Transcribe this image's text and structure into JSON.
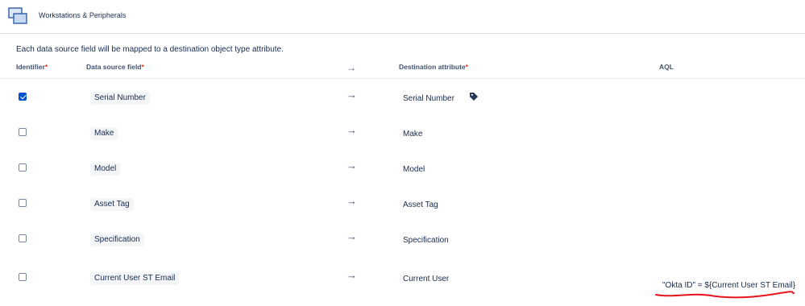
{
  "header": {
    "title": "Workstations & Peripherals",
    "icon": "object-type-icon"
  },
  "description": "Each data source field will be mapped to a destination object type attribute.",
  "columns": {
    "identifier": "Identifier",
    "source": "Data source field",
    "destination": "Destination attribute",
    "aql": "AQL",
    "required_mark": "*"
  },
  "rows": [
    {
      "checked": true,
      "source": "Serial Number",
      "destination": "Serial Number",
      "has_tag": true
    },
    {
      "checked": false,
      "source": "Make",
      "destination": "Make"
    },
    {
      "checked": false,
      "source": "Model",
      "destination": "Model"
    },
    {
      "checked": false,
      "source": "Asset Tag",
      "destination": "Asset Tag"
    },
    {
      "checked": false,
      "source": "Specification",
      "destination": "Specification"
    },
    {
      "checked": false,
      "source": "Current User ST Email",
      "destination": "Current User"
    }
  ],
  "aql_value": "\"Okta ID\" = ${Current User ST Email}",
  "colors": {
    "accent": "#0052cc",
    "required": "#de350b",
    "annotation": "#e8141b"
  }
}
